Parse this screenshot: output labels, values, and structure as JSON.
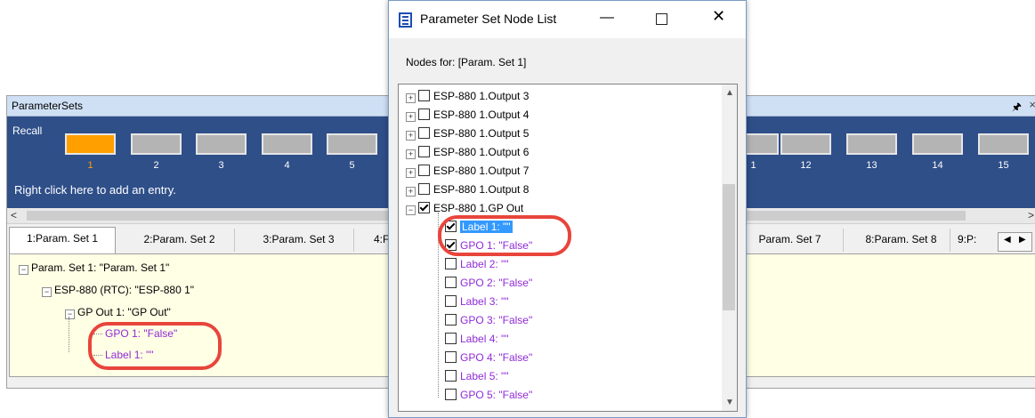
{
  "param_sets": {
    "title": "ParameterSets",
    "pin_icon": "pin-icon",
    "recall_label": "Recall",
    "left_slots": [
      "1",
      "2",
      "3",
      "4",
      "5"
    ],
    "right_slots": [
      "1",
      "12",
      "13",
      "14",
      "15"
    ],
    "active_color": "#ff9f00",
    "hint": "Right click here to add an entry.",
    "tabs": [
      "1:Param. Set 1",
      "2:Param. Set 2",
      "3:Param. Set 3",
      "4:F",
      "Param. Set 7",
      "8:Param. Set 8",
      "9:P:"
    ],
    "tree": {
      "root": "Param. Set 1: \"Param. Set 1\"",
      "device": "ESP-880 (RTC): \"ESP-880 1\"",
      "group": "GP Out 1: \"GP Out\"",
      "leaf1": "GPO 1: \"False\"",
      "leaf2": "Label 1: \"\""
    }
  },
  "dialog": {
    "title": "Parameter Set Node List",
    "nodes_for": "Nodes for: [Param. Set 1]",
    "items": [
      {
        "label": "ESP-880 1.Output 3",
        "checked": false
      },
      {
        "label": "ESP-880 1.Output 4",
        "checked": false
      },
      {
        "label": "ESP-880 1.Output 5",
        "checked": false
      },
      {
        "label": "ESP-880 1.Output 6",
        "checked": false
      },
      {
        "label": "ESP-880 1.Output 7",
        "checked": false
      },
      {
        "label": "ESP-880 1.Output 8",
        "checked": false
      },
      {
        "label": "ESP-880 1.GP Out",
        "checked": true
      }
    ],
    "children": [
      {
        "label": "Label 1: \"\"",
        "checked": true,
        "selected": true
      },
      {
        "label": "GPO 1: \"False\"",
        "checked": true,
        "selected": false
      },
      {
        "label": "Label 2: \"\"",
        "checked": false,
        "selected": false
      },
      {
        "label": "GPO 2: \"False\"",
        "checked": false,
        "selected": false
      },
      {
        "label": "Label 3: \"\"",
        "checked": false,
        "selected": false
      },
      {
        "label": "GPO 3: \"False\"",
        "checked": false,
        "selected": false
      },
      {
        "label": "Label 4: \"\"",
        "checked": false,
        "selected": false
      },
      {
        "label": "GPO 4: \"False\"",
        "checked": false,
        "selected": false
      },
      {
        "label": "Label 5: \"\"",
        "checked": false,
        "selected": false
      },
      {
        "label": "GPO 5: \"False\"",
        "checked": false,
        "selected": false
      }
    ],
    "highlight_color": "#e8453c",
    "child_color": "#8f2bd6"
  }
}
